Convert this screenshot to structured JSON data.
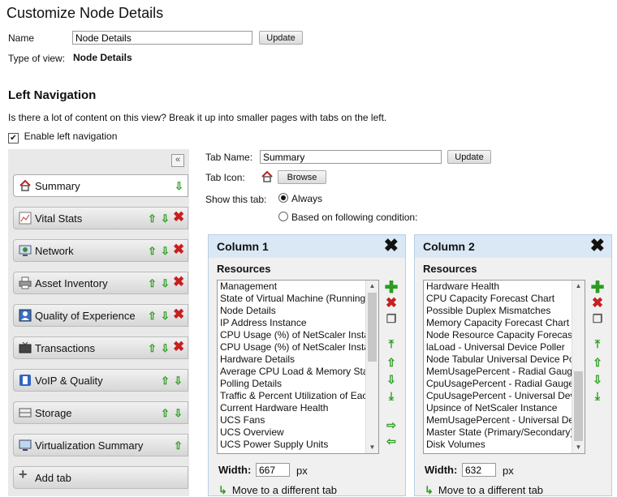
{
  "page": {
    "title": "Customize Node Details",
    "name_label": "Name",
    "name_value": "Node Details",
    "update_label": "Update",
    "type_label": "Type of view:",
    "type_value": "Node Details"
  },
  "left_nav": {
    "heading": "Left Navigation",
    "description": "Is there a lot of content on this view? Break it up into smaller pages with tabs on the left.",
    "enable_label": "Enable left navigation",
    "enabled": true,
    "collapse_glyph": "«",
    "tabs": [
      {
        "label": "Summary",
        "icon": "home-icon"
      },
      {
        "label": "Vital Stats",
        "icon": "chart-icon"
      },
      {
        "label": "Network",
        "icon": "network-icon"
      },
      {
        "label": "Asset Inventory",
        "icon": "printer-icon"
      },
      {
        "label": "Quality of Experience",
        "icon": "user-icon"
      },
      {
        "label": "Transactions",
        "icon": "tv-icon"
      },
      {
        "label": "VoIP & Quality",
        "icon": "phone-icon"
      },
      {
        "label": "Storage",
        "icon": "storage-icon"
      },
      {
        "label": "Virtualization Summary",
        "icon": "monitor-icon"
      }
    ],
    "add_tab_label": "Add tab"
  },
  "tab_settings": {
    "name_label": "Tab Name:",
    "name_value": "Summary",
    "update_label": "Update",
    "icon_label": "Tab Icon:",
    "browse_label": "Browse",
    "show_label": "Show this tab:",
    "option_always": "Always",
    "option_condition": "Based on following condition:",
    "selected": "Always"
  },
  "columns": [
    {
      "title": "Column 1",
      "resources_label": "Resources",
      "resources": [
        "Management",
        "State of Virtual Machine (Running)",
        "Node Details",
        "IP Address Instance",
        "CPU Usage (%) of NetScaler Instance",
        "CPU Usage (%) of NetScaler Instance",
        "Hardware Details",
        "Average CPU Load & Memory Statistics",
        "Polling Details",
        "Traffic & Percent Utilization of Each Interface",
        "Current Hardware Health",
        "UCS Fans",
        "UCS Overview",
        "UCS Power Supply Units"
      ],
      "width_label": "Width:",
      "width_value": "667",
      "width_unit": "px",
      "move_label": "Move to a different tab"
    },
    {
      "title": "Column 2",
      "resources_label": "Resources",
      "resources": [
        "Hardware Health",
        "CPU Capacity Forecast Chart",
        "Possible Duplex Mismatches",
        "Memory Capacity Forecast Chart",
        "Node Resource Capacity Forecast",
        "laLoad - Universal Device Poller",
        "Node Tabular Universal Device Poller",
        "MemUsagePercent - Radial Gauge",
        "CpuUsagePercent - Radial Gauge",
        "CpuUsagePercent - Universal Device Poller",
        "Upsince of NetScaler Instance",
        "MemUsagePercent - Universal Device Poller",
        "Master State (Primary/Secondary)",
        "Disk Volumes"
      ],
      "width_label": "Width:",
      "width_value": "632",
      "width_unit": "px",
      "move_label": "Move to a different tab"
    }
  ],
  "colors": {
    "accent_green": "#2a9d1f",
    "delete_red": "#c81e1e",
    "column_header": "#dae8f5"
  }
}
